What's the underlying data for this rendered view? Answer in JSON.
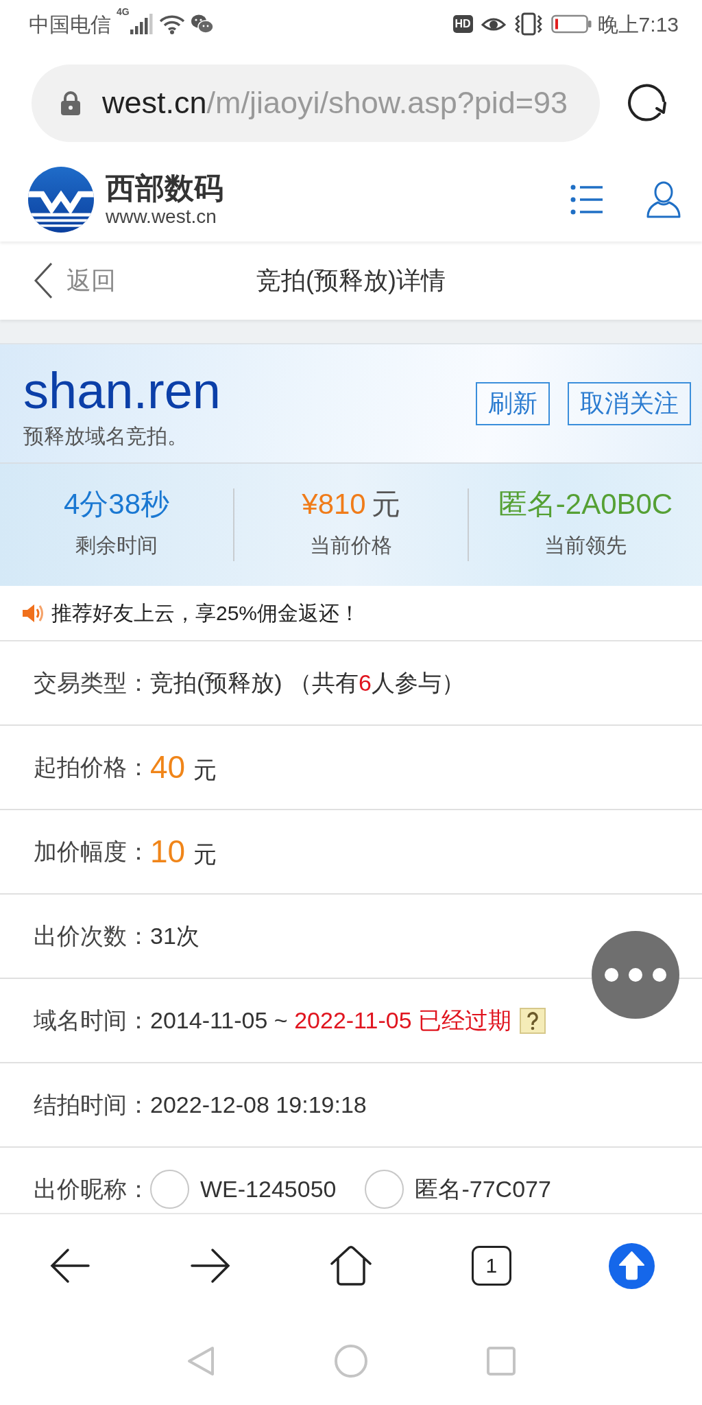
{
  "status_bar": {
    "carrier": "中国电信",
    "network": "4G",
    "hd_badge": "HD",
    "time": "晚上7:13"
  },
  "address_bar": {
    "host": "west.cn",
    "path": "/m/jiaoyi/show.asp?pid=93"
  },
  "site_header": {
    "brand_name": "西部数码",
    "brand_url": "www.west.cn"
  },
  "page_nav": {
    "back_label": "返回",
    "title": "竞拍(预释放)详情"
  },
  "domain": {
    "name": "shan.ren",
    "subtitle": "预释放域名竞拍。",
    "buttons": [
      "刷新",
      "取消关注"
    ]
  },
  "stats": [
    {
      "kind": "time",
      "value": "4分38秒",
      "label": "剩余时间"
    },
    {
      "kind": "price",
      "value": "¥810",
      "unit": "元",
      "label": "当前价格"
    },
    {
      "kind": "leader",
      "value": "匿名-2A0B0C",
      "label": "当前领先"
    }
  ],
  "promo": {
    "text": "推荐好友上云，享25%佣金返还！"
  },
  "details": [
    {
      "kind": "text",
      "label": "交易类型：",
      "parts": [
        {
          "kind": "plain",
          "text": "竞拍(预释放) （共有"
        },
        {
          "kind": "alert",
          "text": "6"
        },
        {
          "kind": "plain",
          "text": "人参与）"
        }
      ],
      "help": false
    },
    {
      "kind": "amount",
      "label": "起拍价格：",
      "amount": "40",
      "unit": "元"
    },
    {
      "kind": "amount",
      "label": "加价幅度：",
      "amount": "10",
      "unit": "元"
    },
    {
      "kind": "text",
      "label": "出价次数：",
      "parts": [
        {
          "kind": "plain",
          "text": "31次"
        }
      ],
      "help": false
    },
    {
      "kind": "text",
      "label": "域名时间：",
      "parts": [
        {
          "kind": "plain",
          "text": "2014-11-05 ~ "
        },
        {
          "kind": "alert",
          "text": "2022-11-05 已经过期"
        }
      ],
      "help": true
    },
    {
      "kind": "text",
      "label": "结拍时间：",
      "parts": [
        {
          "kind": "plain",
          "text": "2022-12-08 19:19:18"
        }
      ],
      "help": false
    },
    {
      "kind": "radio",
      "label": "出价昵称：",
      "options": [
        {
          "label": "WE-1245050",
          "selected": false
        },
        {
          "label": "匿名-77C077",
          "selected": false
        }
      ]
    }
  ],
  "toolbar": {
    "tab_count": "1"
  }
}
